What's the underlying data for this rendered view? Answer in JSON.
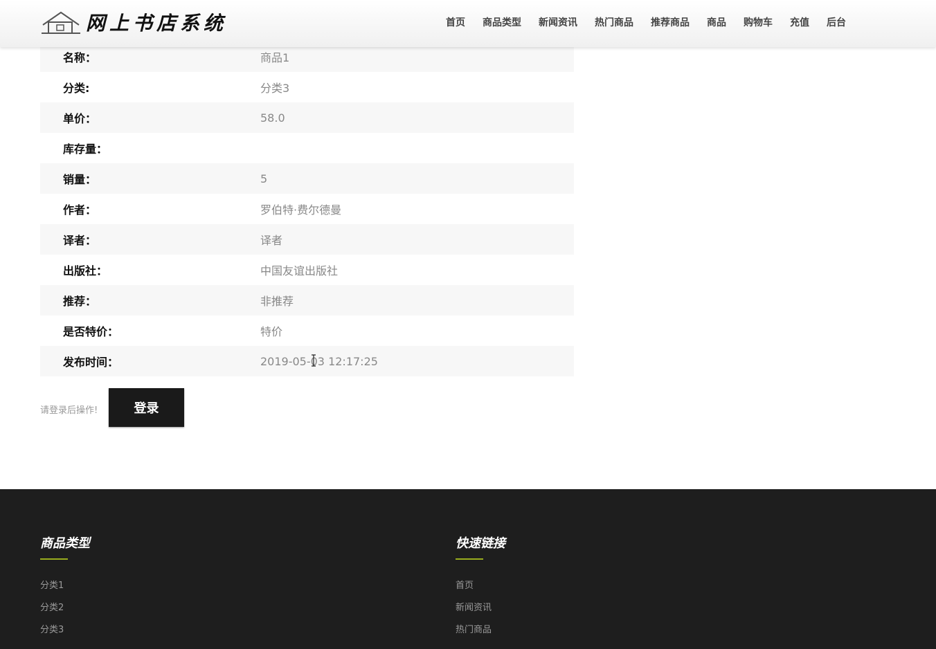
{
  "header": {
    "logo_text": "网上书店系统",
    "nav": [
      "首页",
      "商品类型",
      "新闻资讯",
      "热门商品",
      "推荐商品",
      "商品",
      "购物车",
      "充值",
      "后台"
    ]
  },
  "detail": {
    "rows": [
      {
        "label": "名称：",
        "value": "商品1"
      },
      {
        "label": "分类:",
        "value": "分类3"
      },
      {
        "label": "单价：",
        "value": "58.0"
      },
      {
        "label": "库存量：",
        "value": ""
      },
      {
        "label": "销量：",
        "value": "5"
      },
      {
        "label": "作者：",
        "value": "罗伯特·费尔德曼"
      },
      {
        "label": "译者：",
        "value": "译者"
      },
      {
        "label": "出版社：",
        "value": "中国友谊出版社"
      },
      {
        "label": "推荐：",
        "value": "非推荐"
      },
      {
        "label": "是否特价：",
        "value": "特价"
      },
      {
        "label": "发布时间：",
        "value": "2019-05-03 12:17:25"
      }
    ]
  },
  "login": {
    "hint": "请登录后操作!",
    "button": "登录"
  },
  "footer": {
    "col1": {
      "title": "商品类型",
      "links": [
        "分类1",
        "分类2",
        "分类3"
      ]
    },
    "col2": {
      "title": "快速链接",
      "links": [
        "首页",
        "新闻资讯",
        "热门商品"
      ]
    },
    "accent_color": "#9aae1e"
  }
}
